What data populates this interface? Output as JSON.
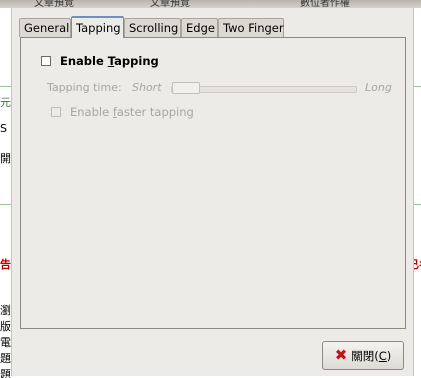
{
  "background": {
    "tabs": [
      "文章預覽",
      "文章預覽",
      "數位者作權"
    ],
    "left_chars": [
      "元",
      "S",
      "開",
      "告",
      "瀏",
      "版",
      "電",
      "題",
      "題"
    ],
    "right_chars": [
      "t",
      "t",
      "|",
      "已名"
    ]
  },
  "dialog": {
    "tabs": [
      {
        "label": "General"
      },
      {
        "label": "Tapping"
      },
      {
        "label": "Scrolling"
      },
      {
        "label": "Edge"
      },
      {
        "label": "Two Finger"
      }
    ],
    "enable_tapping": {
      "prefix": "Enable ",
      "mnemonic": "T",
      "suffix": "apping",
      "checked": false
    },
    "tapping_time": {
      "label": "Tapping time:",
      "min_label": "Short",
      "max_label": "Long",
      "value_fraction": 0.0
    },
    "enable_faster": {
      "prefix": "Enable ",
      "mnemonic": "f",
      "suffix": "aster tapping",
      "checked": false
    },
    "close_button": {
      "label": "關閉(",
      "mnemonic": "C",
      "suffix": ")"
    }
  },
  "colors": {
    "accent_tab": "#6e8fc0",
    "close_icon": "#c0141a",
    "dialog_bg": "#edebe7"
  }
}
